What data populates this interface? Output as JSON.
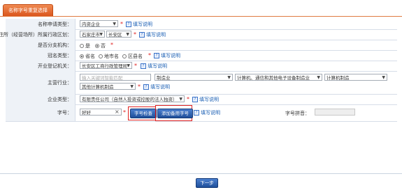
{
  "tab": {
    "label": "名称字号重复选择"
  },
  "rows": {
    "apply_type": {
      "label": "名称申请类型：",
      "value": "内资企业",
      "help": "填写说明"
    },
    "residence": {
      "label": "住所（经营场所）所属行政区划：",
      "city": "石家庄市",
      "district": "长安区",
      "help": "填写说明"
    },
    "branch": {
      "label": "是否分支机构：",
      "options": [
        "是",
        "否"
      ],
      "selected": "否"
    },
    "crown": {
      "label": "冠名类型：",
      "options": [
        "省名",
        "地市名",
        "区县名"
      ],
      "selected": "省名",
      "help": "填写说明"
    },
    "registrar": {
      "label": "开业登记机关：",
      "value": "长安区工商行政管理局",
      "help": "填写说明"
    },
    "industry": {
      "label": "主营行业：",
      "search_placeholder": "输入关键词智能匹配",
      "level1": "制造业",
      "level2": "计算机、通信和其他电子设备制造业",
      "level3": "计算机制造",
      "level4": "其他计算机制造",
      "help": "填写说明"
    },
    "company_type": {
      "label": "企业类型：",
      "value": "有限责任公司（自然人投资或控股的法人独资）",
      "help": "填写说明"
    },
    "brand": {
      "label": "字号：",
      "value": "好好",
      "clear": "×",
      "check_button": "字号检查",
      "add_button": "添加备用字号",
      "help": "填写说明",
      "pinyin_label": "字号拼音：",
      "pinyin_value": ""
    }
  },
  "footer": {
    "next_button": "下一步"
  },
  "colors": {
    "tab": "#e06a30",
    "label_bg": "#eef2f7",
    "button": "#2a5aa8",
    "required": "#e02020",
    "highlight": "#e02020"
  }
}
